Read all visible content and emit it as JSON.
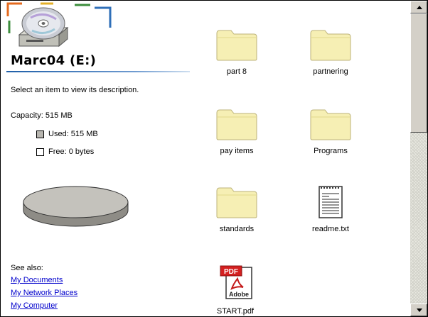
{
  "drive": {
    "title": "Marc04 (E:)",
    "description": "Select an item to view its description."
  },
  "capacity": {
    "label": "Capacity: 515 MB",
    "used_label": "Used: 515 MB",
    "free_label": "Free: 0 bytes",
    "used_color": "#b8b6b0",
    "free_color": "#ffffff",
    "used_fraction": 1.0
  },
  "see_also": {
    "heading": "See also:",
    "links": [
      "My Documents",
      "My Network Places",
      "My Computer"
    ]
  },
  "files": [
    {
      "name": "part 8",
      "icon": "folder-icon"
    },
    {
      "name": "partnering",
      "icon": "folder-icon"
    },
    {
      "name": "pay items",
      "icon": "folder-icon"
    },
    {
      "name": "Programs",
      "icon": "folder-icon"
    },
    {
      "name": "standards",
      "icon": "folder-icon"
    },
    {
      "name": "readme.txt",
      "icon": "text-file-icon"
    },
    {
      "name": "START.pdf",
      "icon": "pdf-file-icon"
    }
  ],
  "colors": {
    "link": "#0000cc",
    "folder": "#f6efb4",
    "title_rule": "#1f5fa8"
  }
}
